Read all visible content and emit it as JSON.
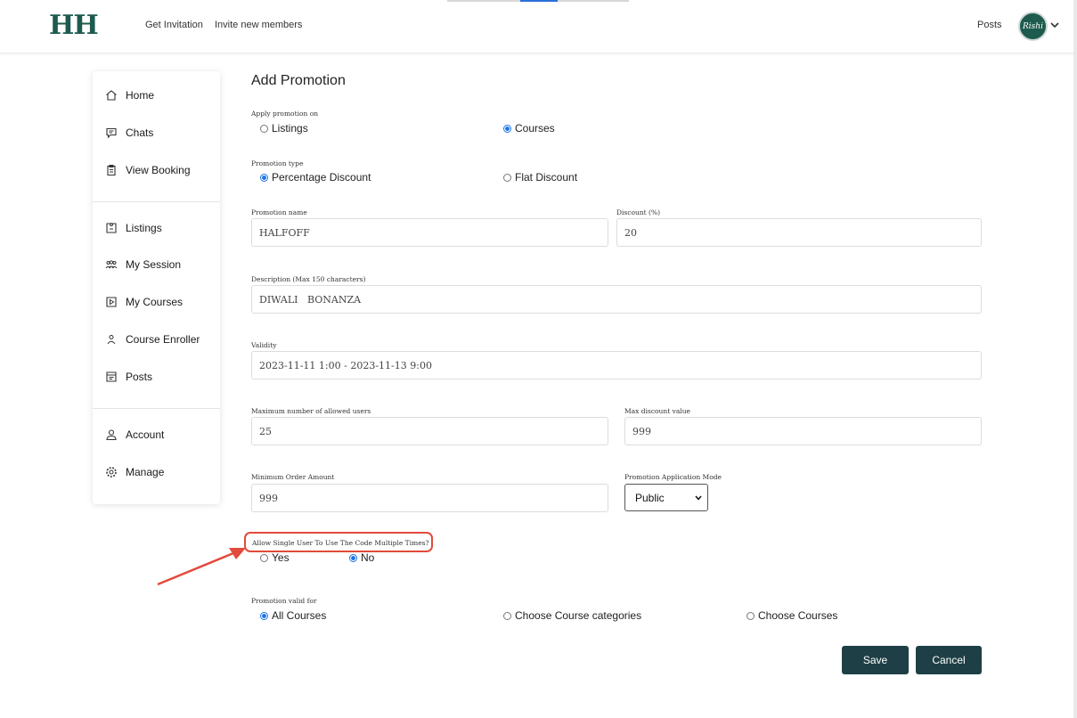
{
  "header": {
    "logo": "HH",
    "nav": [
      "Get Invitation",
      "Invite new members"
    ],
    "posts_link": "Posts",
    "avatar_text": "Rishi"
  },
  "sidebar": {
    "group1": [
      "Home",
      "Chats",
      "View Booking"
    ],
    "group2": [
      "Listings",
      "My Session",
      "My Courses",
      "Course Enroller",
      "Posts"
    ],
    "group3": [
      "Account",
      "Manage"
    ]
  },
  "form": {
    "title": "Add Promotion",
    "apply_on": {
      "label": "Apply promotion on",
      "options": [
        "Listings",
        "Courses"
      ],
      "selected": "Courses"
    },
    "promo_type": {
      "label": "Promotion type",
      "options": [
        "Percentage Discount",
        "Flat Discount"
      ],
      "selected": "Percentage Discount"
    },
    "promo_name": {
      "label": "Promotion name",
      "value": "HALFOFF"
    },
    "discount": {
      "label": "Discount (%)",
      "value": "20"
    },
    "description": {
      "label": "Description (Max 150 characters)",
      "value": "DIWALI   BONANZA"
    },
    "validity": {
      "label": "Validity",
      "value": "2023-11-11 1:00 - 2023-11-13 9:00"
    },
    "max_users": {
      "label": "Maximum number of allowed users",
      "value": "25"
    },
    "max_discount": {
      "label": "Max discount value",
      "value": "999"
    },
    "min_order": {
      "label": "Minimum Order Amount",
      "value": "999"
    },
    "app_mode": {
      "label": "Promotion Application Mode",
      "value": "Public"
    },
    "multi_use": {
      "label": "Allow Single User To Use The Code Multiple Times?",
      "options": [
        "Yes",
        "No"
      ],
      "selected": "No"
    },
    "valid_for": {
      "label": "Promotion valid for",
      "options": [
        "All Courses",
        "Choose Course categories",
        "Choose Courses"
      ],
      "selected": "All Courses"
    },
    "save": "Save",
    "cancel": "Cancel"
  },
  "colors": {
    "brand": "#1e5b4f",
    "button": "#1e3f46",
    "highlight": "#e24a3b",
    "radio_active": "#1a73e8"
  }
}
